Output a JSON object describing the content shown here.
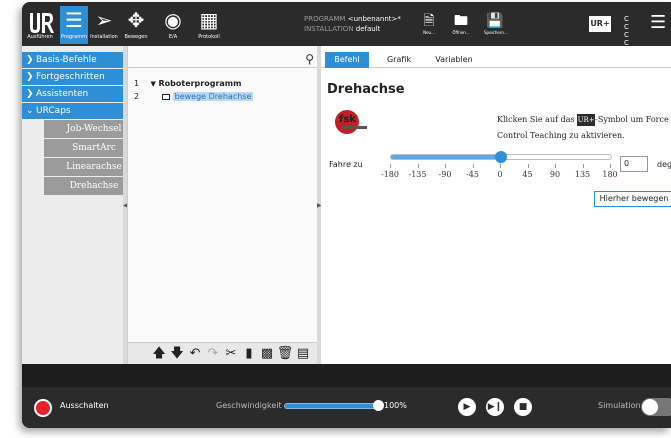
{
  "colors": {
    "accent": "#2f8fd6",
    "topbar": "#2b2b2b",
    "power": "#e8212a"
  },
  "topbar": {
    "logo": "UR",
    "buttons": [
      {
        "label": "Ausführen",
        "icon": "ur-logo-icon"
      },
      {
        "label": "Programm",
        "icon": "program-icon"
      },
      {
        "label": "Installation",
        "icon": "installation-icon"
      },
      {
        "label": "Bewegen",
        "icon": "move-icon"
      },
      {
        "label": "E/A",
        "icon": "io-icon"
      },
      {
        "label": "Protokoll",
        "icon": "log-icon"
      }
    ],
    "program_label": "PROGRAMM",
    "program_value": "<unbenannt>*",
    "installation_label": "INSTALLATION",
    "installation_value": "default",
    "file_buttons": [
      {
        "label": "Neu...",
        "icon": "new-file-icon"
      },
      {
        "label": "Öffnen...",
        "icon": "open-folder-icon"
      },
      {
        "label": "Speichern...",
        "icon": "save-icon"
      }
    ],
    "right_logo": "UR+",
    "cc_label": "C C C C"
  },
  "leftnav": {
    "sections": [
      {
        "label": "Basis-Befehle",
        "expanded": false
      },
      {
        "label": "Fortgeschritten",
        "expanded": false
      },
      {
        "label": "Assistenten",
        "expanded": false
      },
      {
        "label": "URCaps",
        "expanded": true
      }
    ],
    "urcaps_items": [
      "Job-Wechsel",
      "SmartArc",
      "Linearachse",
      "Drehachse"
    ]
  },
  "tree": {
    "rows": [
      {
        "num": "1",
        "label": "Roboterprogramm"
      },
      {
        "num": "2",
        "label": "bewege Drehachse"
      }
    ],
    "tools": [
      "arrow-up-icon",
      "arrow-down-icon",
      "undo-icon",
      "redo-icon",
      "cut-icon",
      "copy-icon",
      "paste-icon",
      "delete-icon",
      "suppress-icon"
    ]
  },
  "panel": {
    "tabs": [
      "Befehl",
      "Grafik",
      "Variablen"
    ],
    "active_tab": "Befehl",
    "title": "Drehachse",
    "hint_part1": "Klicken Sie auf das",
    "hint_icon": "UR+",
    "hint_part2": "-Symbol um Force Control Teaching zu aktivieren.",
    "move_label": "Fahre zu",
    "slider": {
      "min": -180,
      "max": 180,
      "value": 0
    },
    "tick_labels": [
      "-180",
      "-135",
      "-90",
      "-45",
      "0",
      "45",
      "90",
      "135",
      "180"
    ],
    "input_value": "0",
    "unit": "deg",
    "move_button": "Hierher bewegen",
    "logo_text": "fsk"
  },
  "bottombar": {
    "power_label": "Ausschalten",
    "speed_label": "Geschwindigkeit",
    "speed_fraction": 1.0,
    "speed_value": "100%",
    "controls": [
      "play-icon",
      "step-icon",
      "stop-icon"
    ],
    "simulation_label": "Simulation"
  }
}
